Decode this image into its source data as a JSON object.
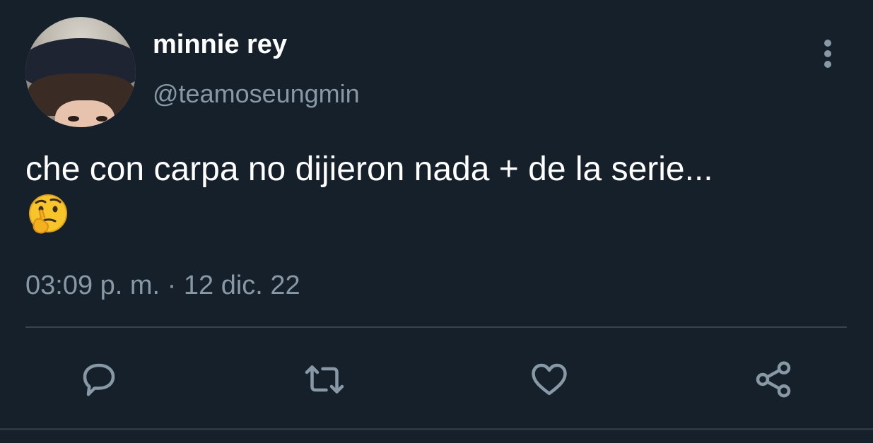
{
  "tweet": {
    "display_name": "minnie rey",
    "handle": "@teamoseungmin",
    "text": "che con carpa no dijieron nada + de la serie...",
    "emoji": "thinking-face",
    "timestamp": "03:09 p. m. · 12 dic. 22"
  },
  "actions": {
    "reply_icon": "reply-icon",
    "retweet_icon": "retweet-icon",
    "like_icon": "heart-icon",
    "share_icon": "share-icon"
  },
  "colors": {
    "background": "#15202b",
    "secondary_text": "#8899a6",
    "divider": "#38444d"
  }
}
